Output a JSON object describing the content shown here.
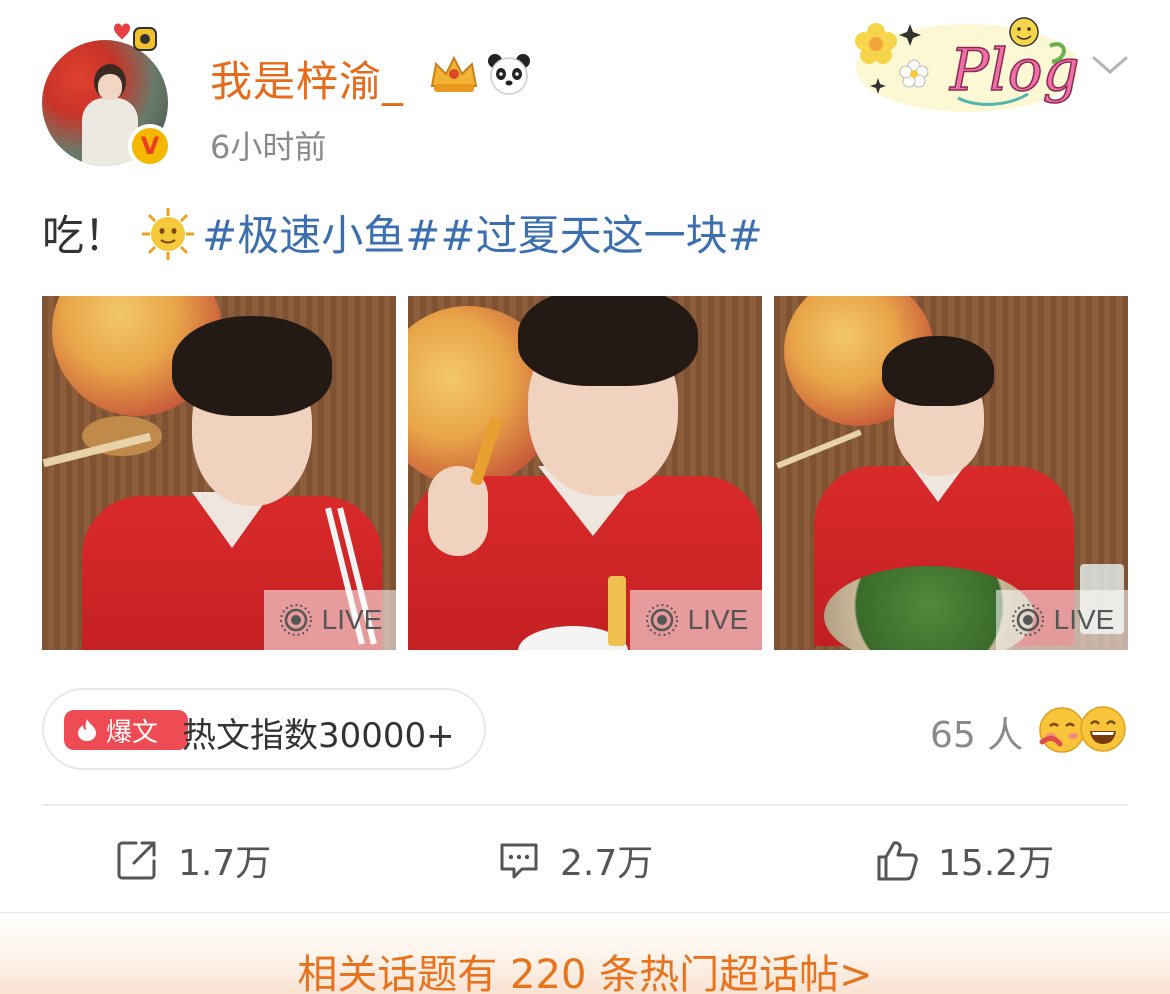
{
  "header": {
    "username": "我是梓渝_",
    "time": "6小时前",
    "badges": [
      "crown-icon",
      "panda-icon"
    ],
    "verified_mark": "V"
  },
  "sticker": {
    "label": "Plog",
    "icon": "plog-sticker-icon"
  },
  "post": {
    "text": "吃！",
    "emoji": "sun-face-icon",
    "tags": "#极速小鱼##过夏天这一块#"
  },
  "photos": [
    {
      "badge": "LIVE",
      "icon": "live-photo-icon"
    },
    {
      "badge": "LIVE",
      "icon": "live-photo-icon"
    },
    {
      "badge": "LIVE",
      "icon": "live-photo-icon"
    }
  ],
  "hot": {
    "badge": "爆文",
    "text": "热文指数30000+"
  },
  "reactions": {
    "count": "65 人"
  },
  "actions": {
    "repost": "1.7万",
    "comment": "2.7万",
    "like": "15.2万"
  },
  "bottom": {
    "text": "相关话题有 220 条热门超话帖>"
  },
  "colors": {
    "username": "#e86b1a",
    "topic": "#3b6fb0",
    "hot_badge": "#ef4b54",
    "bottom_link": "#e8731f"
  }
}
